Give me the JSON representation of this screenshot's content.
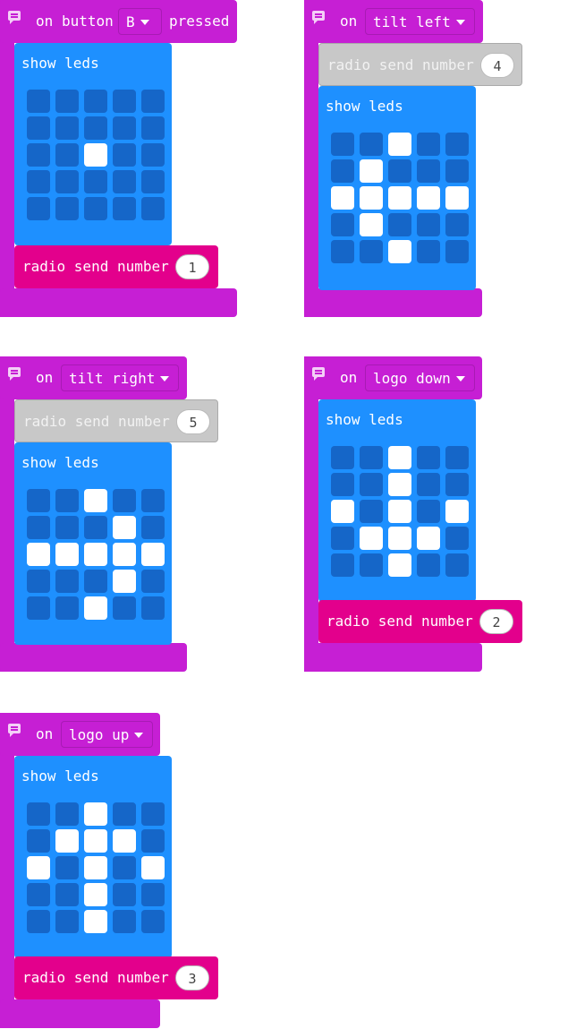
{
  "blocks": [
    {
      "event": {
        "prefix": "on",
        "field": "button B",
        "field_label": "button",
        "field_value": "B",
        "suffix": "pressed"
      },
      "show_leds_label": "show leds",
      "radio_label": "radio send number",
      "radio_value": "1",
      "radio_disabled": false,
      "leds": [
        [
          0,
          0,
          0,
          0,
          0
        ],
        [
          0,
          0,
          0,
          0,
          0
        ],
        [
          0,
          0,
          1,
          0,
          0
        ],
        [
          0,
          0,
          0,
          0,
          0
        ],
        [
          0,
          0,
          0,
          0,
          0
        ]
      ]
    },
    {
      "event": {
        "prefix": "on",
        "field": "tilt left"
      },
      "show_leds_label": "show leds",
      "radio_label": "radio send number",
      "radio_value": "4",
      "radio_disabled": true,
      "leds": [
        [
          0,
          0,
          1,
          0,
          0
        ],
        [
          0,
          1,
          0,
          0,
          0
        ],
        [
          1,
          1,
          1,
          1,
          1
        ],
        [
          0,
          1,
          0,
          0,
          0
        ],
        [
          0,
          0,
          1,
          0,
          0
        ]
      ]
    },
    {
      "event": {
        "prefix": "on",
        "field": "tilt right"
      },
      "show_leds_label": "show leds",
      "radio_label": "radio send number",
      "radio_value": "5",
      "radio_disabled": true,
      "leds": [
        [
          0,
          0,
          1,
          0,
          0
        ],
        [
          0,
          0,
          0,
          1,
          0
        ],
        [
          1,
          1,
          1,
          1,
          1
        ],
        [
          0,
          0,
          0,
          1,
          0
        ],
        [
          0,
          0,
          1,
          0,
          0
        ]
      ]
    },
    {
      "event": {
        "prefix": "on",
        "field": "logo down"
      },
      "show_leds_label": "show leds",
      "radio_label": "radio send number",
      "radio_value": "2",
      "radio_disabled": false,
      "leds": [
        [
          0,
          0,
          1,
          0,
          0
        ],
        [
          0,
          0,
          1,
          0,
          0
        ],
        [
          1,
          0,
          1,
          0,
          1
        ],
        [
          0,
          1,
          1,
          1,
          0
        ],
        [
          0,
          0,
          1,
          0,
          0
        ]
      ]
    },
    {
      "event": {
        "prefix": "on",
        "field": "logo up"
      },
      "show_leds_label": "show leds",
      "radio_label": "radio send number",
      "radio_value": "3",
      "radio_disabled": false,
      "leds": [
        [
          0,
          0,
          1,
          0,
          0
        ],
        [
          0,
          1,
          1,
          1,
          0
        ],
        [
          1,
          0,
          1,
          0,
          1
        ],
        [
          0,
          0,
          1,
          0,
          0
        ],
        [
          0,
          0,
          1,
          0,
          0
        ]
      ]
    }
  ],
  "colors": {
    "event": "#c61fd4",
    "basic": "#1e90ff",
    "radio": "#e3008c",
    "led_off": "#1566c8",
    "led_on": "#ffffff",
    "disabled": "#c8c8c8"
  }
}
